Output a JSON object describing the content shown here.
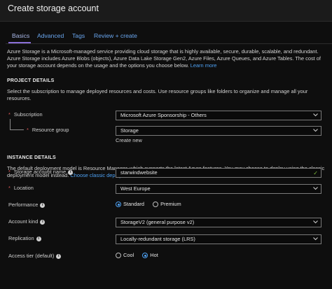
{
  "window": {
    "title": "Create storage account"
  },
  "tabs": [
    {
      "label": "Basics",
      "active": true
    },
    {
      "label": "Advanced",
      "active": false
    },
    {
      "label": "Tags",
      "active": false
    },
    {
      "label": "Review + create",
      "active": false
    }
  ],
  "intro": {
    "text": "Azure Storage is a Microsoft-managed service providing cloud storage that is highly available, secure, durable, scalable, and redundant. Azure Storage includes Azure Blobs (objects), Azure Data Lake Storage Gen2, Azure Files, Azure Queues, and Azure Tables. The cost of your storage account depends on the usage and the options you choose below.",
    "link": "Learn more"
  },
  "project": {
    "heading": "PROJECT DETAILS",
    "description": "Select the subscription to manage deployed resources and costs. Use resource groups like folders to organize and manage all your resources.",
    "subscription_label": "Subscription",
    "subscription_value": "Microsoft Azure Sponsorship - Others",
    "resource_group_label": "Resource group",
    "resource_group_value": "Storage",
    "create_new": "Create new"
  },
  "instance": {
    "heading": "INSTANCE DETAILS",
    "description": "The default deployment model is Resource Manager, which supports the latest Azure features. You may choose to deploy using the classic deployment model instead.",
    "classic_link": "Choose classic deployment model",
    "name_label": "Storage account name",
    "name_value": "starwindwebsite",
    "location_label": "Location",
    "location_value": "West Europe",
    "performance_label": "Performance",
    "performance_options": [
      "Standard",
      "Premium"
    ],
    "performance_selected": "Standard",
    "account_kind_label": "Account kind",
    "account_kind_value": "StorageV2 (general purpose v2)",
    "replication_label": "Replication",
    "replication_value": "Locally-redundant storage (LRS)",
    "access_tier_label": "Access tier (default)",
    "access_tier_options": [
      "Cool",
      "Hot"
    ],
    "access_tier_selected": "Hot"
  },
  "colors": {
    "background": "#0e0e0e",
    "link": "#4ea1f3",
    "tab_underline": "#8a6fd8",
    "required": "#e05a5a",
    "valid_check": "#7fc13e"
  },
  "icons": {
    "info": "info-icon",
    "dropdown": "chevron-down-icon",
    "valid": "checkmark-icon"
  }
}
